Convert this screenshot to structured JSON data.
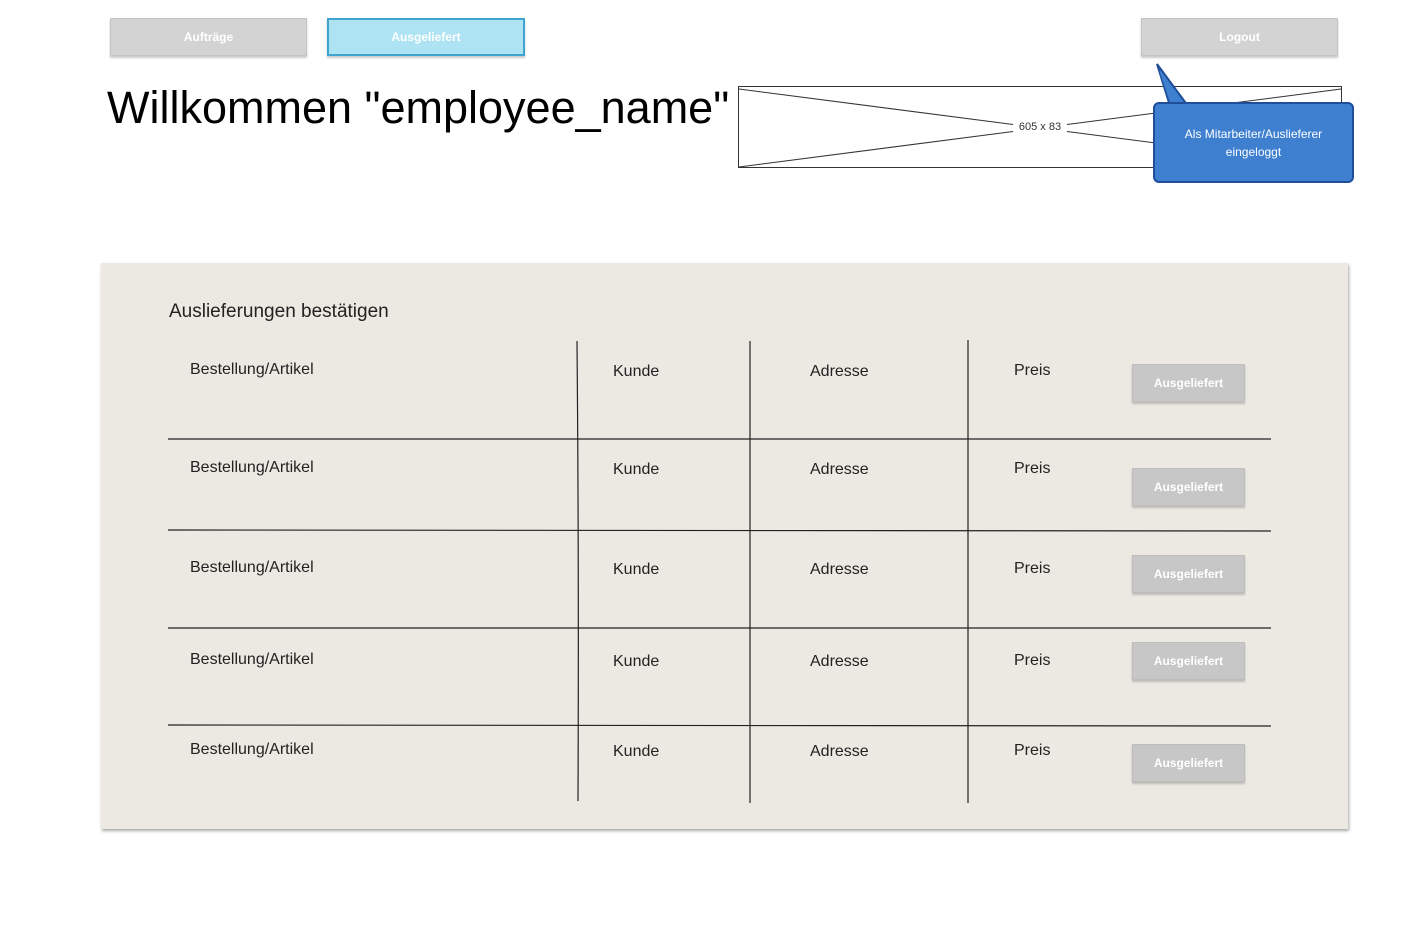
{
  "nav": {
    "auftraege_label": "Aufträge",
    "ausgeliefert_label": "Ausgeliefert",
    "logout_label": "Logout"
  },
  "header": {
    "title": "Willkommen \"employee_name\"",
    "image_placeholder": "605 x 83",
    "callout": "Als Mitarbeiter/Auslieferer eingeloggt"
  },
  "panel": {
    "title": "Auslieferungen bestätigen",
    "rows": [
      {
        "order": "Bestellung/Artikel",
        "customer": "Kunde",
        "address": "Adresse",
        "price": "Preis",
        "button": "Ausgeliefert"
      },
      {
        "order": "Bestellung/Artikel",
        "customer": "Kunde",
        "address": "Adresse",
        "price": "Preis",
        "button": "Ausgeliefert"
      },
      {
        "order": "Bestellung/Artikel",
        "customer": "Kunde",
        "address": "Adresse",
        "price": "Preis",
        "button": "Ausgeliefert"
      },
      {
        "order": "Bestellung/Artikel",
        "customer": "Kunde",
        "address": "Adresse",
        "price": "Preis",
        "button": "Ausgeliefert"
      },
      {
        "order": "Bestellung/Artikel",
        "customer": "Kunde",
        "address": "Adresse",
        "price": "Preis",
        "button": "Ausgeliefert"
      }
    ]
  },
  "colors": {
    "nav_button": "#d3d3d3",
    "nav_active": "#aee3f4",
    "nav_active_border": "#3fa4cf",
    "callout": "#3e7fd0",
    "panel_bg": "#ece9e3",
    "row_button": "#c7c7c7"
  }
}
